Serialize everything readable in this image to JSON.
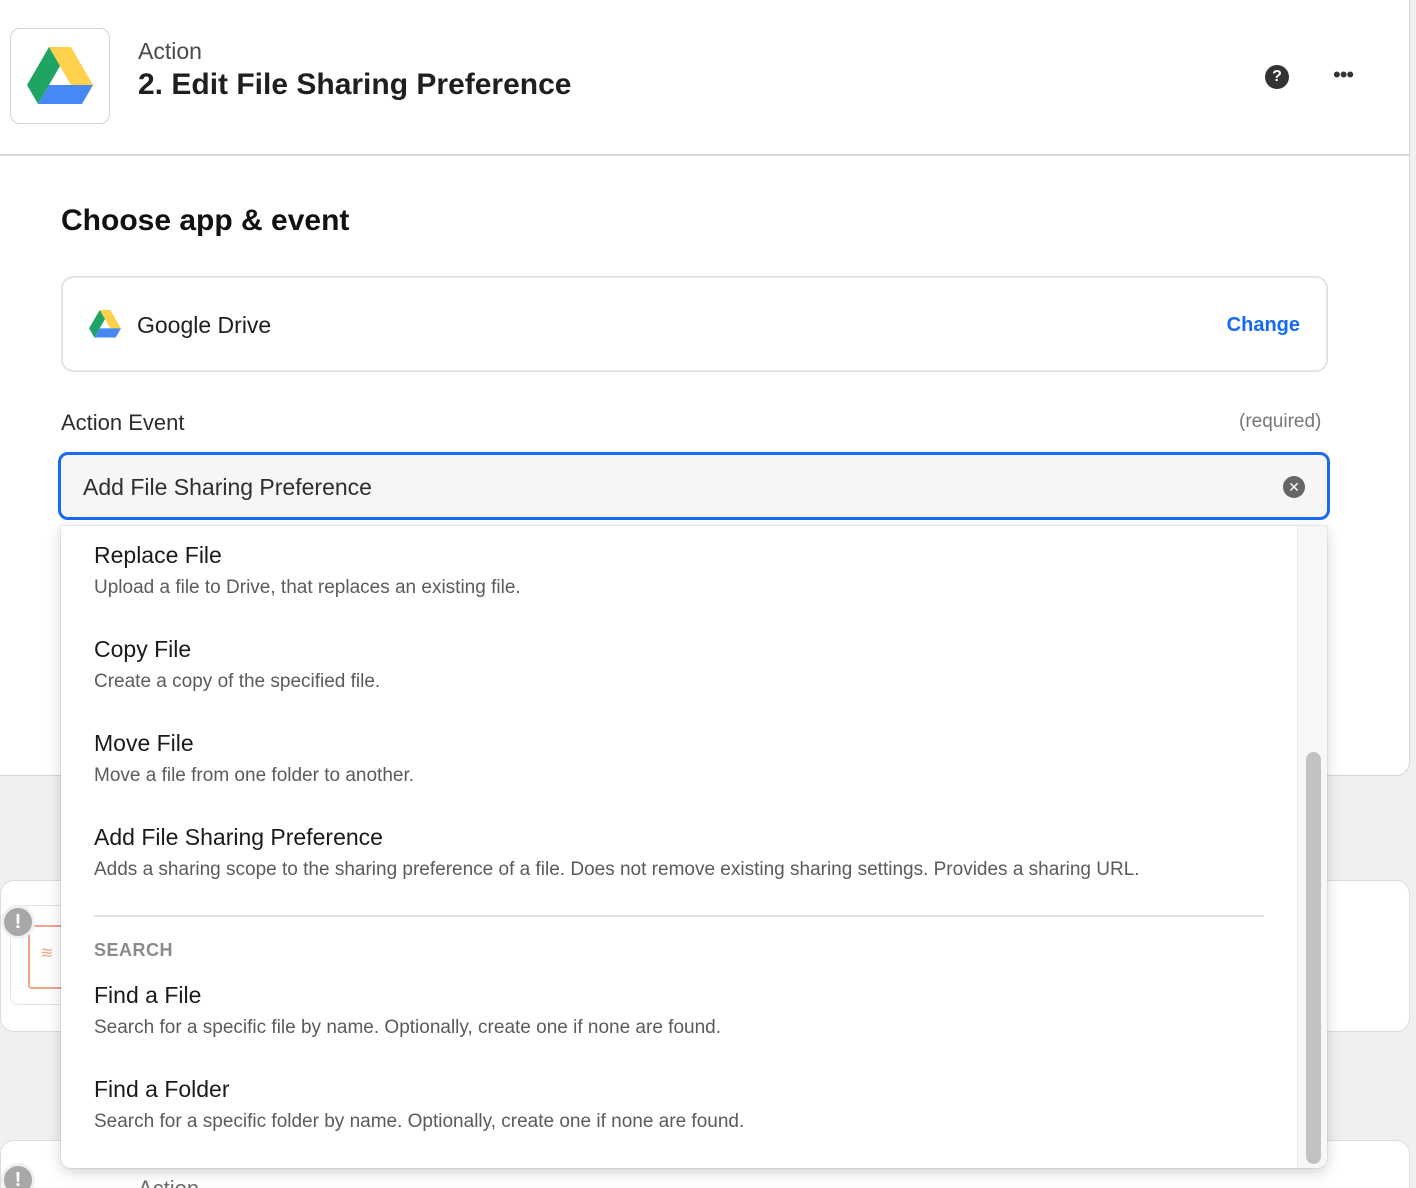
{
  "header": {
    "step_kind": "Action",
    "step_title": "2. Edit File Sharing Preference"
  },
  "section": {
    "title": "Choose app & event"
  },
  "app": {
    "name": "Google Drive",
    "change_label": "Change"
  },
  "event_field": {
    "label": "Action Event",
    "required": "(required)",
    "value": "Add File Sharing Preference"
  },
  "dropdown": {
    "actions": [
      {
        "title": "Replace File",
        "description": "Upload a file to Drive, that replaces an existing file."
      },
      {
        "title": "Copy File",
        "description": "Create a copy of the specified file."
      },
      {
        "title": "Move File",
        "description": "Move a file from one folder to another."
      },
      {
        "title": "Add File Sharing Preference",
        "description": "Adds a sharing scope to the sharing preference of a file. Does not remove existing sharing settings. Provides a sharing URL."
      }
    ],
    "search_group_label": "SEARCH",
    "searches": [
      {
        "title": "Find a File",
        "description": "Search for a specific file by name. Optionally, create one if none are found."
      },
      {
        "title": "Find a Folder",
        "description": "Search for a specific folder by name. Optionally, create one if none are found."
      }
    ]
  },
  "background": {
    "next_step_kind": "Action"
  },
  "icons": {
    "help": "question-circle-icon",
    "more": "ellipsis-icon",
    "clear": "close-circle-icon",
    "app": "google-drive-icon"
  },
  "colors": {
    "accent": "#136bf5",
    "focus_border": "#1a6bf0",
    "drive_green": "#1fa463",
    "drive_yellow": "#ffd04b",
    "drive_blue": "#4688f4"
  }
}
